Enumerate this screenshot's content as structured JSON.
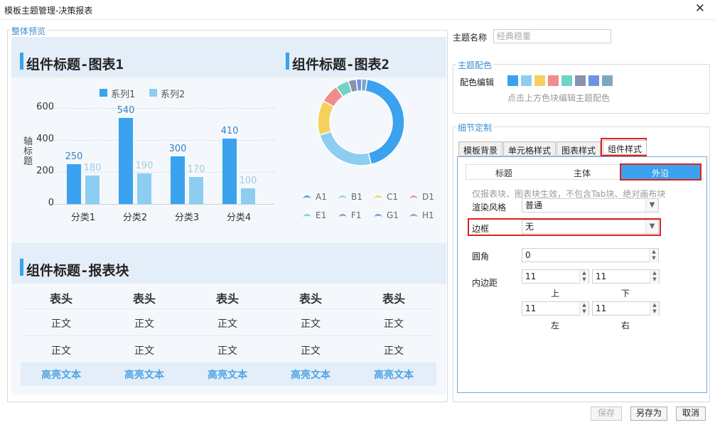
{
  "window": {
    "title": "模板主题管理-决策报表",
    "close": "✕"
  },
  "preview": {
    "group_label": "整体预览",
    "chart1_title": "组件标题-图表1",
    "chart2_title": "组件标题-图表2",
    "report_title": "组件标题-报表块"
  },
  "chart_data": [
    {
      "type": "bar",
      "title": "",
      "ylabel": "轴标题",
      "ylim": [
        0,
        600
      ],
      "yticks": [
        "600",
        "400",
        "200",
        "0"
      ],
      "categories": [
        "分类1",
        "分类2",
        "分类3",
        "分类4"
      ],
      "series": [
        {
          "name": "系列1",
          "values": [
            250,
            540,
            300,
            410
          ],
          "color": "#3aa2ef"
        },
        {
          "name": "系列2",
          "values": [
            180,
            190,
            170,
            100
          ],
          "color": "#8ecdf2"
        }
      ]
    },
    {
      "type": "pie",
      "title": "",
      "donut": true,
      "labels": [
        "A1",
        "B1",
        "C1",
        "D1",
        "E1",
        "F1",
        "G1",
        "H1"
      ],
      "values": [
        44,
        24,
        13,
        7,
        5,
        3,
        2,
        2
      ],
      "colors": [
        "#3aa2ef",
        "#8ecdf2",
        "#f5d15b",
        "#f28c8c",
        "#6fd3c7",
        "#8a92ad",
        "#6e93e6",
        "#7ea6be"
      ]
    }
  ],
  "report": {
    "headers": [
      "表头",
      "表头",
      "表头",
      "表头",
      "表头"
    ],
    "rows": [
      [
        "正文",
        "正文",
        "正文",
        "正文",
        "正文"
      ],
      [
        "正文",
        "正文",
        "正文",
        "正文",
        "正文"
      ]
    ],
    "highlight": [
      "高亮文本",
      "高亮文本",
      "高亮文本",
      "高亮文本",
      "高亮文本"
    ]
  },
  "settings": {
    "theme_name_label": "主题名称",
    "theme_name_placeholder": "经典稳重",
    "color_group": "主题配色",
    "color_edit_label": "配色编辑",
    "swatches": [
      "#3aa2ef",
      "#8ecdf2",
      "#f5d15b",
      "#f28c8c",
      "#6fd3c7",
      "#8a92ad",
      "#6e93e6",
      "#7ea6be"
    ],
    "color_hint": "点击上方色块编辑主题配色",
    "detail_group": "细节定制",
    "tabs": [
      "模板背景",
      "单元格样式",
      "图表样式",
      "组件样式"
    ],
    "subtabs": [
      "标题",
      "主体",
      "外沿"
    ],
    "hint": "仅报表块、图表块生效，不包含Tab块、绝对画布块",
    "render_label": "渲染风格",
    "render_value": "普通",
    "border_label": "边框",
    "border_value": "无",
    "radius_label": "圆角",
    "radius_value": "0",
    "padding_label": "内边距",
    "padding": {
      "top": "11",
      "bottom": "11",
      "left": "11",
      "right": "11"
    },
    "pad_names": {
      "top": "上",
      "bottom": "下",
      "left": "左",
      "right": "右"
    }
  },
  "footer": {
    "save": "保存",
    "save_as": "另存为",
    "cancel": "取消"
  },
  "colors": {
    "accent": "#3aa2ef",
    "highlight_red": "#e02020"
  }
}
